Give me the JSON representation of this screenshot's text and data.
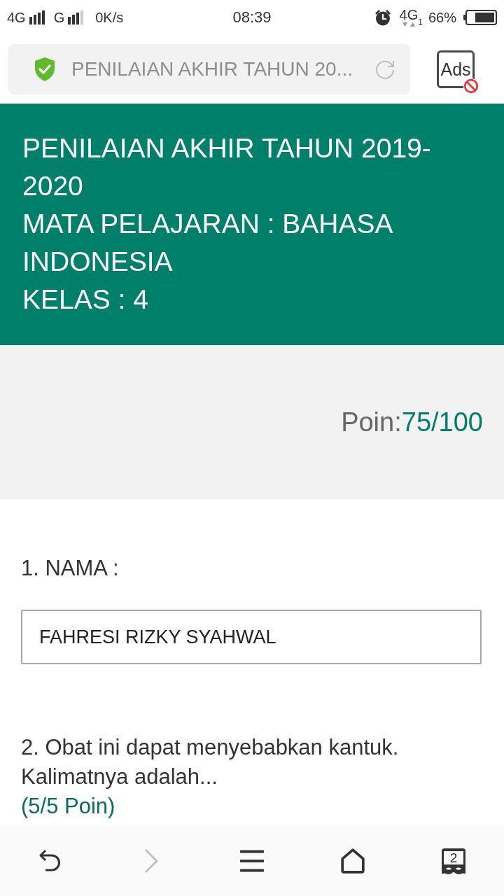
{
  "status_bar": {
    "network_1": "4G",
    "network_2": "G",
    "speed": "0K/s",
    "time": "08:39",
    "network_3": "4G",
    "sim": "1",
    "battery": "66%"
  },
  "address_bar": {
    "title": "PENILAIAN AKHIR TAHUN 20..."
  },
  "ad_block_button": {
    "label": "Ads"
  },
  "header": {
    "title": "PENILAIAN AKHIR TAHUN 2019-2020",
    "subject": "MATA PELAJARAN : BAHASA INDONESIA",
    "grade": "KELAS : 4"
  },
  "score": {
    "label": "Poin:",
    "value": "75/100"
  },
  "questions": [
    {
      "kind": "text_input",
      "text": "1. NAMA :",
      "answer": "FAHRESI RIZKY SYAHWAL"
    },
    {
      "kind": "prompt",
      "text": "2. Obat ini dapat menyebabkan kantuk. Kalimatnya adalah...",
      "points": "(5/5 Poin)"
    }
  ],
  "bottom_nav": [
    {
      "kind": "back",
      "disabled": false
    },
    {
      "kind": "forward",
      "disabled": true
    },
    {
      "kind": "menu",
      "disabled": false
    },
    {
      "kind": "home",
      "disabled": false
    },
    {
      "kind": "tabs",
      "count": "2",
      "disabled": false
    }
  ]
}
